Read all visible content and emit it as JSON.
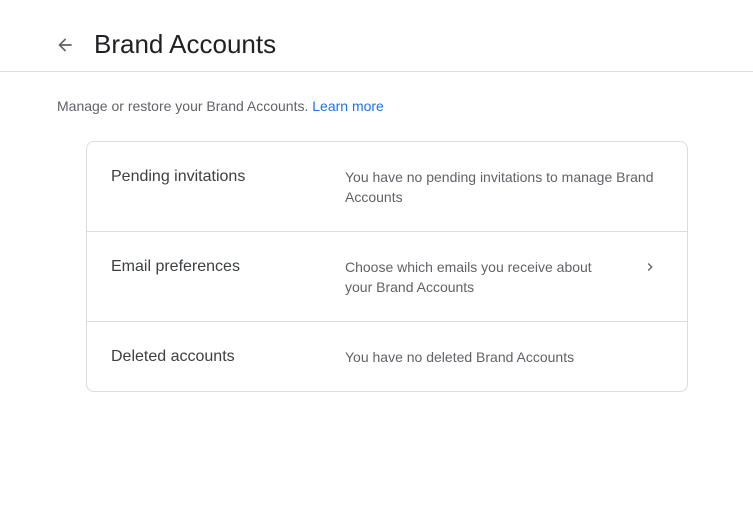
{
  "header": {
    "title": "Brand Accounts",
    "back_icon": "arrow-back-icon"
  },
  "intro": {
    "text": "Manage or restore your Brand Accounts. ",
    "link": "Learn more"
  },
  "rows": [
    {
      "label": "Pending invitations",
      "value": "You have no pending invitations to manage Brand Accounts"
    },
    {
      "label": "Email preferences",
      "value": "Choose which emails you receive about your Brand Accounts",
      "icon": "chevron-right-icon"
    },
    {
      "label": "Deleted accounts",
      "value": "You have no deleted Brand Accounts"
    }
  ],
  "colors": {
    "link": "#1a73e8",
    "divider": "#dadce0",
    "text_secondary": "#5f6368"
  }
}
